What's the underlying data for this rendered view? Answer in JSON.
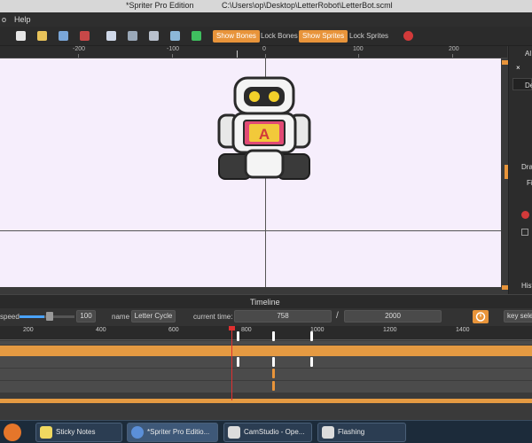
{
  "window": {
    "title": "*Spriter Pro Edition",
    "path": "C:\\Users\\op\\Desktop\\LetterRobot\\LetterBot.scml"
  },
  "menu": {
    "items": [
      "o",
      "Help"
    ]
  },
  "toolbar": {
    "show_bones": "Show Bones",
    "lock_bones": "Lock Bones",
    "show_sprites": "Show Sprites",
    "lock_sprites": "Lock Sprites"
  },
  "canvas_ruler": {
    "labels": [
      "-200",
      "-100",
      "0",
      "100",
      "200"
    ]
  },
  "canvas": {
    "letter": "A"
  },
  "right_panel": {
    "labels": [
      "Al",
      "De",
      "Drag",
      "Fi",
      "Hist"
    ]
  },
  "timeline": {
    "title": "Timeline",
    "speed_label": "speed",
    "speed_value": "100",
    "name_label": "name",
    "name_value": "Letter Cycle",
    "current_time_label": "current time:",
    "current_time_value": "758",
    "separator": "/",
    "total_time_value": "2000",
    "key_select_label": "key sele",
    "ruler_labels": [
      "200",
      "400",
      "600",
      "800",
      "1000",
      "1200",
      "1400"
    ]
  },
  "taskbar": {
    "items": [
      "Sticky Notes",
      "*Spriter Pro Editio...",
      "CamStudio - Ope...",
      "Flashing"
    ]
  },
  "colors": {
    "accent": "#e8943a",
    "canvas_bg": "#f6eefc",
    "playhead": "#e03030"
  }
}
